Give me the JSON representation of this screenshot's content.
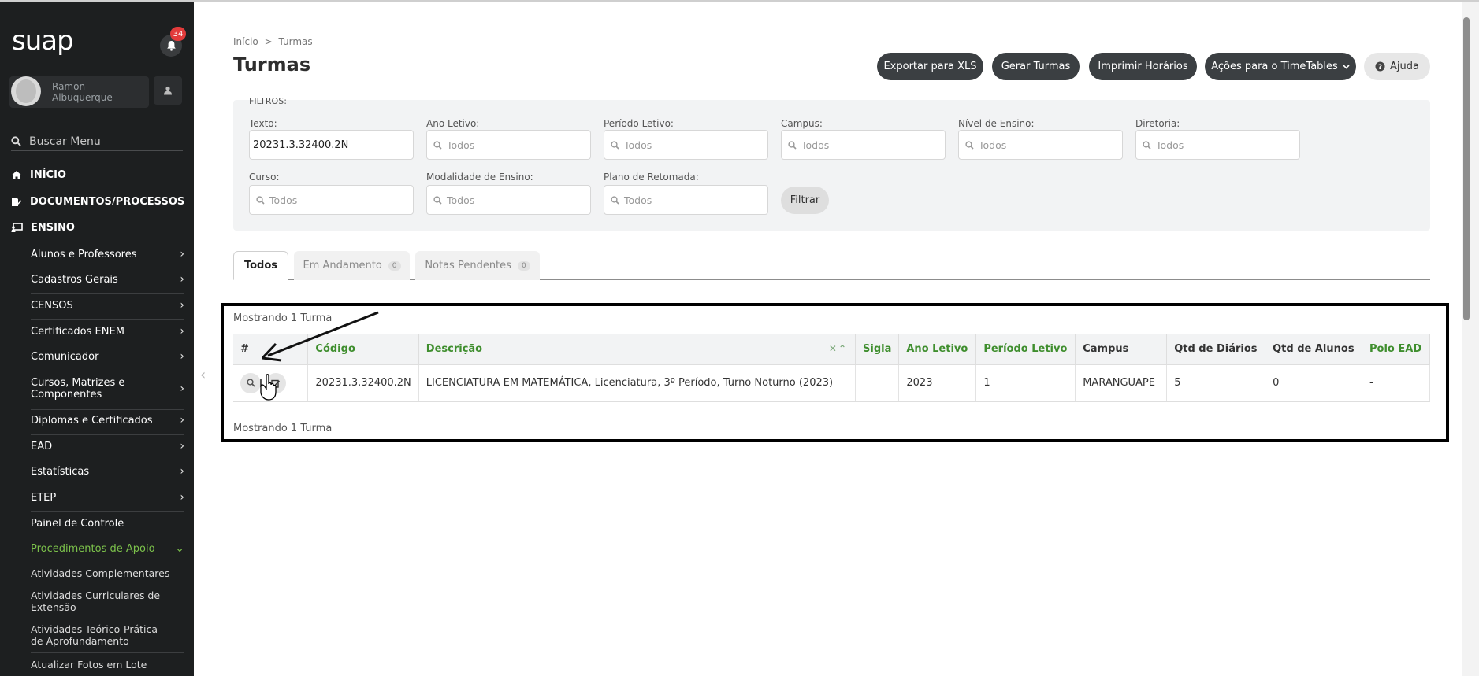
{
  "sidebar": {
    "logo": "suap",
    "notifications": "34",
    "user_name": "Ramon Albuquerque",
    "search_label": "Buscar Menu",
    "main_items": [
      "INÍCIO",
      "DOCUMENTOS/PROCESSOS",
      "ENSINO"
    ],
    "sub_items": [
      "Alunos e Professores",
      "Cadastros Gerais",
      "CENSOS",
      "Certificados ENEM",
      "Comunicador",
      "Cursos, Matrizes e Componentes",
      "Diplomas e Certificados",
      "EAD",
      "Estatísticas",
      "ETEP",
      "Painel de Controle",
      "Procedimentos de Apoio"
    ],
    "sub_sub_items": [
      "Atividades Complementares",
      "Atividades Curriculares de Extensão",
      "Atividades Teórico-Prática de Aprofundamento",
      "Atualizar Fotos em Lote"
    ]
  },
  "breadcrumb": {
    "home": "Início",
    "separator": ">",
    "current": "Turmas"
  },
  "page_title": "Turmas",
  "actions": {
    "export": "Exportar para XLS",
    "generate": "Gerar Turmas",
    "print": "Imprimir Horários",
    "timetables": "Ações para o TimeTables",
    "help": "Ajuda"
  },
  "filters": {
    "title": "FILTROS:",
    "fields": [
      {
        "label": "Texto:",
        "value": "20231.3.32400.2N"
      },
      {
        "label": "Ano Letivo:",
        "value": "Todos"
      },
      {
        "label": "Período Letivo:",
        "value": "Todos"
      },
      {
        "label": "Campus:",
        "value": "Todos"
      },
      {
        "label": "Nível de Ensino:",
        "value": "Todos"
      },
      {
        "label": "Diretoria:",
        "value": "Todos"
      },
      {
        "label": "Curso:",
        "value": "Todos"
      },
      {
        "label": "Modalidade de Ensino:",
        "value": "Todos"
      },
      {
        "label": "Plano de Retomada:",
        "value": "Todos"
      }
    ],
    "submit": "Filtrar"
  },
  "tabs": [
    {
      "label": "Todos"
    },
    {
      "label": "Em Andamento",
      "count": "0"
    },
    {
      "label": "Notas Pendentes",
      "count": "0"
    }
  ],
  "results": {
    "showing": "Mostrando 1 Turma",
    "headers": [
      "#",
      "Código",
      "Descrição",
      "Sigla",
      "Ano Letivo",
      "Período Letivo",
      "Campus",
      "Qtd de Diários",
      "Qtd de Alunos",
      "Polo EAD"
    ],
    "rows": [
      {
        "codigo": "20231.3.32400.2N",
        "descricao": "LICENCIATURA EM MATEMÁTICA, Licenciatura, 3º Período, Turno Noturno (2023)",
        "sigla": "",
        "ano": "2023",
        "periodo": "1",
        "campus": "MARANGUAPE",
        "diarios": "5",
        "alunos": "0",
        "polo": "-"
      }
    ]
  }
}
